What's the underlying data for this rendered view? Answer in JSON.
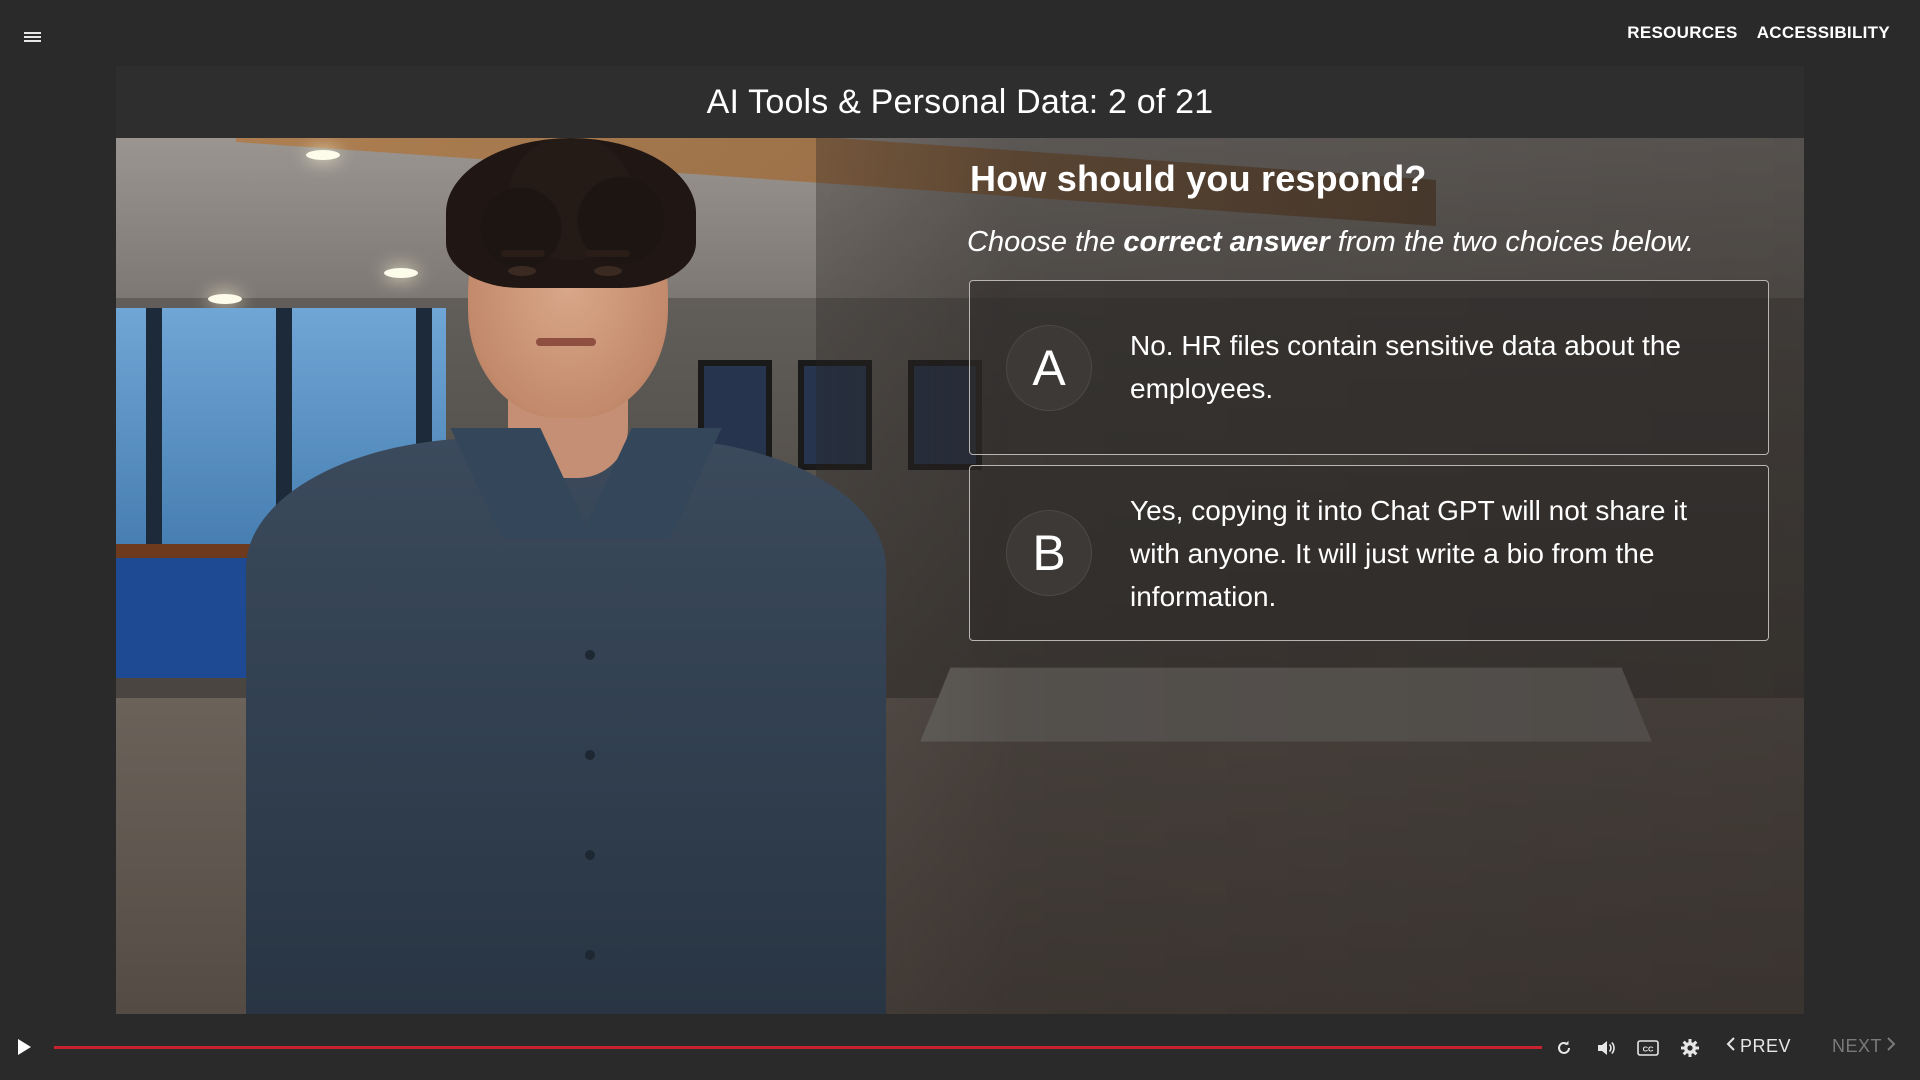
{
  "header": {
    "menu_icon": "hamburger-menu-icon",
    "links": [
      "RESOURCES",
      "ACCESSIBILITY"
    ]
  },
  "slide": {
    "title": "AI Tools & Personal Data: 2 of 21"
  },
  "quiz": {
    "question": "How should you respond?",
    "instruction_prefix": "Choose the ",
    "instruction_emphasis": "correct answer",
    "instruction_suffix": " from the two choices below.",
    "choices": [
      {
        "letter": "A",
        "text": "No. HR files contain sensitive data about the employees."
      },
      {
        "letter": "B",
        "text": "Yes, copying it into Chat GPT will not share it with anyone. It will just write a bio from the information."
      }
    ]
  },
  "player": {
    "play_icon": "play-icon",
    "progress": 1.0,
    "progress_color": "#c8222e",
    "icons": [
      "replay-icon",
      "volume-icon",
      "closed-captions-icon",
      "settings-gear-icon"
    ],
    "cc_label": "CC",
    "prev_label": "PREV",
    "next_label": "NEXT",
    "next_enabled": false
  }
}
